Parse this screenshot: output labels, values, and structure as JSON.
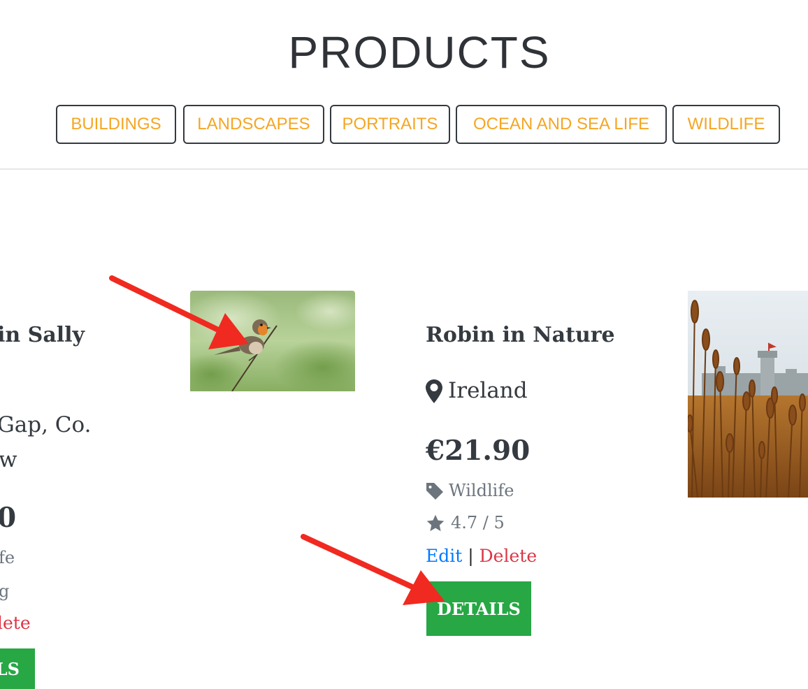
{
  "page": {
    "title": "PRODUCTS"
  },
  "categories": [
    {
      "label": "BUILDINGS"
    },
    {
      "label": "LANDSCAPES"
    },
    {
      "label": "PORTRAITS"
    },
    {
      "label": "OCEAN AND SEA LIFE"
    },
    {
      "label": "WILDLIFE"
    }
  ],
  "products": {
    "left": {
      "title_visible": "in Sally",
      "location_line1": " Gap, Co.",
      "location_line2": "w",
      "price_visible": "0",
      "category_visible": "fe",
      "rating_visible": "g",
      "delete_visible": "lete",
      "details_visible": "LS"
    },
    "center": {
      "title": "Robin in Nature",
      "location": "Ireland",
      "price": "€21.90",
      "category": "Wildlife",
      "rating": "4.7 / 5",
      "edit_label": "Edit",
      "separator": "|",
      "delete_label": "Delete",
      "details_label": "DETAILS"
    }
  },
  "colors": {
    "accent": "#f5a623",
    "details_green": "#28a745",
    "edit_blue": "#007bff",
    "delete_red": "#dc3545",
    "annotation_red": "#f02a20"
  },
  "icons": {
    "location": "map-marker-icon",
    "category": "tag-icon",
    "rating": "star-icon"
  }
}
